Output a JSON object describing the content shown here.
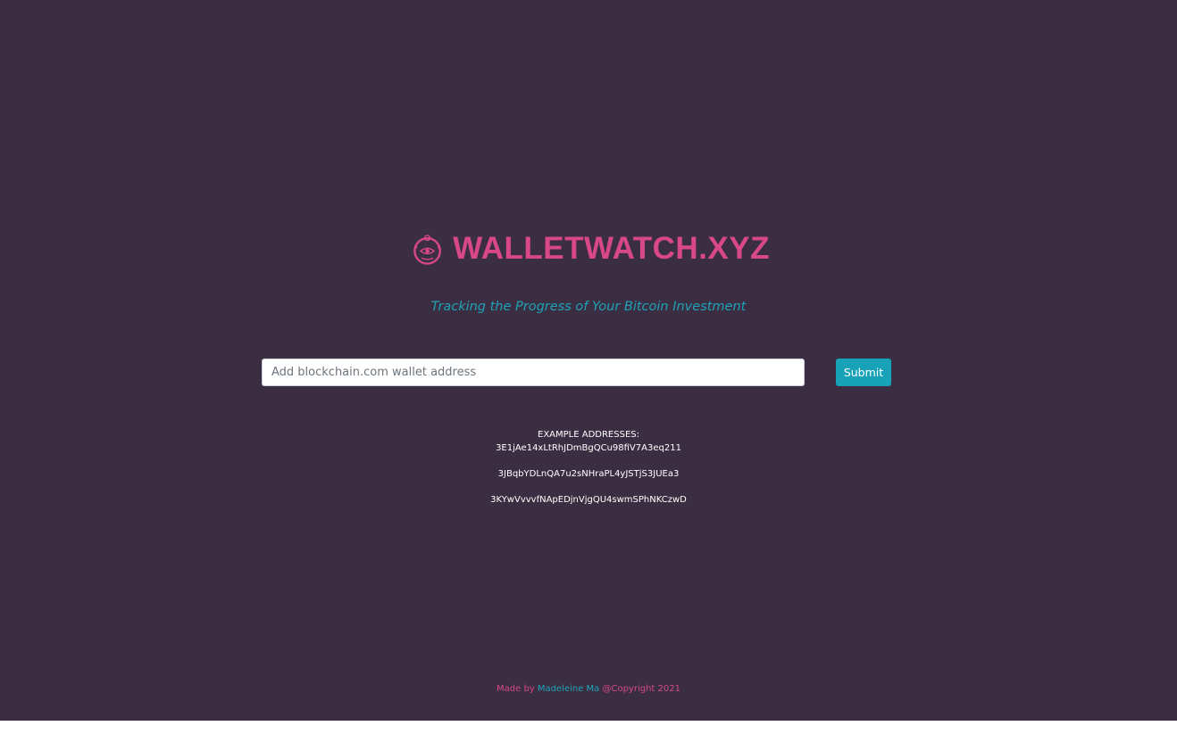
{
  "brand": {
    "name": "WALLETWATCH.XYZ",
    "tagline": "Tracking the Progress of Your Bitcoin Investment",
    "color": "#d7478a",
    "accent": "#1fa2b6",
    "icon": "eye-wallet-icon"
  },
  "search": {
    "placeholder": "Add blockchain.com wallet address",
    "value": "",
    "submit_label": "Submit"
  },
  "examples": {
    "heading": "EXAMPLE ADDRESSES:",
    "addresses": [
      "3E1jAe14xLtRhJDmBgQCu98fiV7A3eq211",
      "3JBqbYDLnQA7u2sNHraPL4yJSTjS3JUEa3",
      "3KYwVvvvfNApEDjnVjgQU4swmSPhNKCzwD"
    ]
  },
  "footer": {
    "made_by": "Made by",
    "author": "Madeleine Ma",
    "copyright": "@Copyright 2021"
  },
  "colors": {
    "background": "#3b2e42",
    "button": "#17a2b8"
  }
}
